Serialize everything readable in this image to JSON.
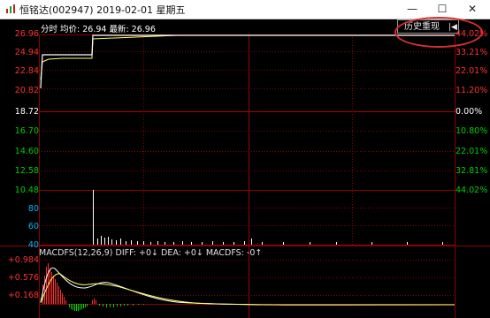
{
  "window": {
    "title": "恒铭达(002947)  2019-02-01  星期五",
    "minimize_glyph": "—",
    "maximize_glyph": "☐",
    "close_glyph": "✕",
    "icon": "app-icon"
  },
  "header": {
    "info_text": "分时  均价: 26.94  最新: 26.96",
    "history_button": "历史重现",
    "history_icon": "arrow-left-icon"
  },
  "price_axis": {
    "up_labels": [
      "26.96",
      "24.94",
      "22.84",
      "20.82"
    ],
    "mid_label": "18.72",
    "down_labels": [
      "16.70",
      "14.60",
      "12.58",
      "10.48"
    ]
  },
  "pct_axis": {
    "up_labels": [
      "44.02%",
      "33.21%",
      "22.01%",
      "11.20%"
    ],
    "mid_label": "0.00%",
    "down_labels": [
      "10.80%",
      "22.01%",
      "32.81%",
      "44.02%"
    ]
  },
  "volume_axis": {
    "labels": [
      "80",
      "60",
      "40"
    ]
  },
  "macd": {
    "label": "MACDFS(12,26,9)  DIFF: +0↓  DEA: +0↓  MACDFS: -0↑",
    "axis_labels": [
      "+0.984",
      "+0.576",
      "+0.168"
    ]
  },
  "colors": {
    "up": "#ff3030",
    "down": "#00d000",
    "neutral": "#ffffff",
    "volume_label": "#00b8ff",
    "grid": "#8a0000",
    "price_line": "#ffffff",
    "avg_line": "#ffff66"
  },
  "chart_data": {
    "type": "line",
    "title": "",
    "xlabel": "",
    "ylabel": "",
    "ylim": [
      10.48,
      26.96
    ],
    "reference_price": 18.72,
    "series": [
      {
        "name": "",
        "points": [
          [
            0,
            22.84
          ],
          [
            0.02,
            24.94
          ],
          [
            0.25,
            24.94
          ],
          [
            0.25,
            26.96
          ],
          [
            1,
            26.96
          ]
        ]
      },
      {
        "name": "均价",
        "points": [
          [
            0,
            22.84
          ],
          [
            0.02,
            24.4
          ],
          [
            0.25,
            24.6
          ],
          [
            0.26,
            26.5
          ],
          [
            1,
            26.94
          ]
        ]
      }
    ],
    "grid": true
  }
}
